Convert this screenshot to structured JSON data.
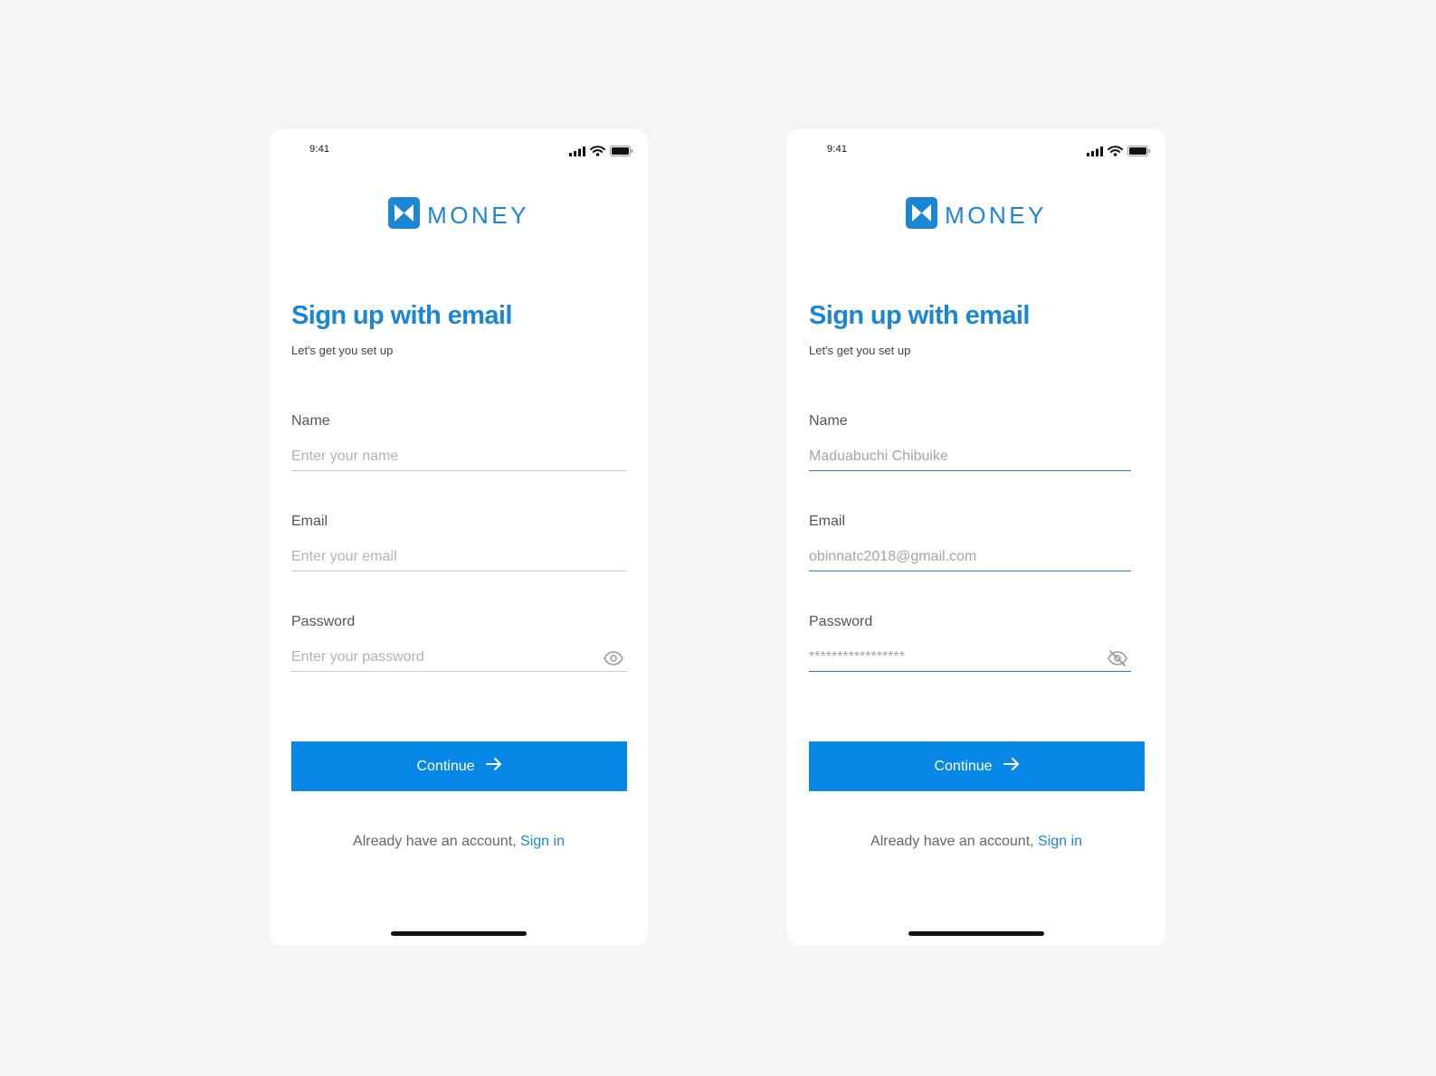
{
  "colors": {
    "background": "#f5f5f5",
    "accent": "#1a86d4",
    "button": "#0788e7",
    "text_muted": "#666666"
  },
  "screens": [
    {
      "status_bar": {
        "time": "9:41",
        "icons": [
          "signal-icon",
          "wifi-icon",
          "battery-icon"
        ]
      },
      "brand": {
        "logo_icon": "money-logo-icon",
        "name": "MONEY"
      },
      "title": "Sign up with email",
      "subtitle": "Let's get you set up",
      "fields": {
        "name": {
          "label": "Name",
          "placeholder": "Enter your name",
          "value": ""
        },
        "email": {
          "label": "Email",
          "placeholder": "Enter your email",
          "value": ""
        },
        "password": {
          "label": "Password",
          "placeholder": "Enter your password",
          "value": "",
          "visibility_icon": "eye-icon"
        }
      },
      "continue_label": "Continue",
      "continue_icon": "arrow-right-icon",
      "signin_prompt": "Already have an account,",
      "signin_link": "Sign in"
    },
    {
      "status_bar": {
        "time": "9:41",
        "icons": [
          "signal-icon",
          "wifi-icon",
          "battery-icon"
        ]
      },
      "brand": {
        "logo_icon": "money-logo-icon",
        "name": "MONEY"
      },
      "title": "Sign up with email",
      "subtitle": "Let's get you set up",
      "fields": {
        "name": {
          "label": "Name",
          "placeholder": "Enter your name",
          "value": "Maduabuchi Chibuike"
        },
        "email": {
          "label": "Email",
          "placeholder": "Enter your email",
          "value": "obinnatc2018@gmail.com"
        },
        "password": {
          "label": "Password",
          "placeholder": "Enter your password",
          "value": "*****************",
          "visibility_icon": "eye-off-icon"
        }
      },
      "continue_label": "Continue",
      "continue_icon": "arrow-right-icon",
      "signin_prompt": "Already have an account,",
      "signin_link": "Sign in"
    }
  ]
}
